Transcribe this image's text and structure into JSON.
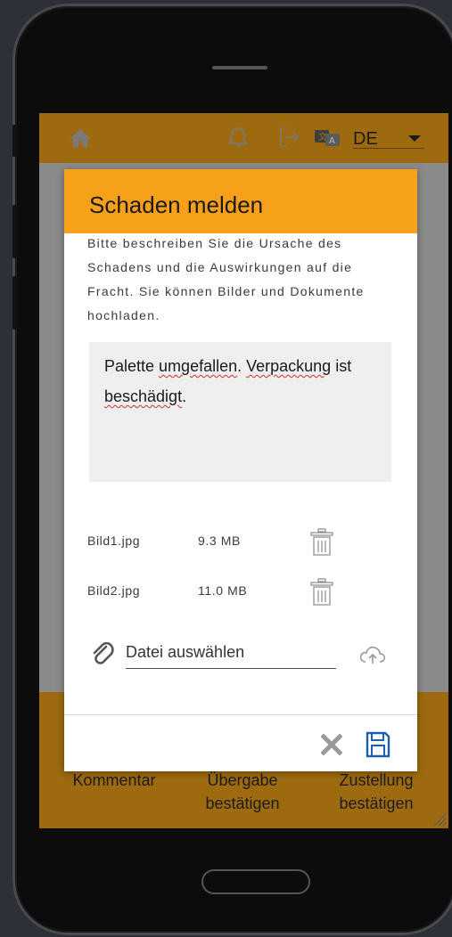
{
  "topbar": {
    "language": "DE",
    "icons": [
      "home-icon",
      "bell-icon",
      "logout-icon",
      "translate-icon",
      "chevron-down-icon"
    ]
  },
  "bottombar": {
    "items": [
      {
        "line1": "Kommentar",
        "line2": ""
      },
      {
        "line1": "Übergabe",
        "line2": "bestätigen"
      },
      {
        "line1": "Zustellung",
        "line2": "bestätigen"
      }
    ]
  },
  "dialog": {
    "title": "Schaden melden",
    "description": "Bitte beschreiben Sie die Ursache des Schadens und die Auswirkungen auf die Fracht. Sie können Bilder und Dokumente hochladen.",
    "comment_value": {
      "w1": "Palette ",
      "w2": "umgefallen",
      "w3": ". ",
      "w4": "Verpackung",
      "w5": " ist ",
      "w6": "beschädigt",
      "w7": "."
    },
    "files": [
      {
        "name": "Bild1.jpg",
        "size": "9.3 MB"
      },
      {
        "name": "Bild2.jpg",
        "size": "11.0 MB"
      }
    ],
    "file_input_placeholder": "Datei auswählen"
  },
  "colors": {
    "header": "#f7a11a",
    "topbar_dimmed": "#9e6a10",
    "save_icon": "#1f5fb0",
    "close_icon": "#9a9a9a"
  }
}
